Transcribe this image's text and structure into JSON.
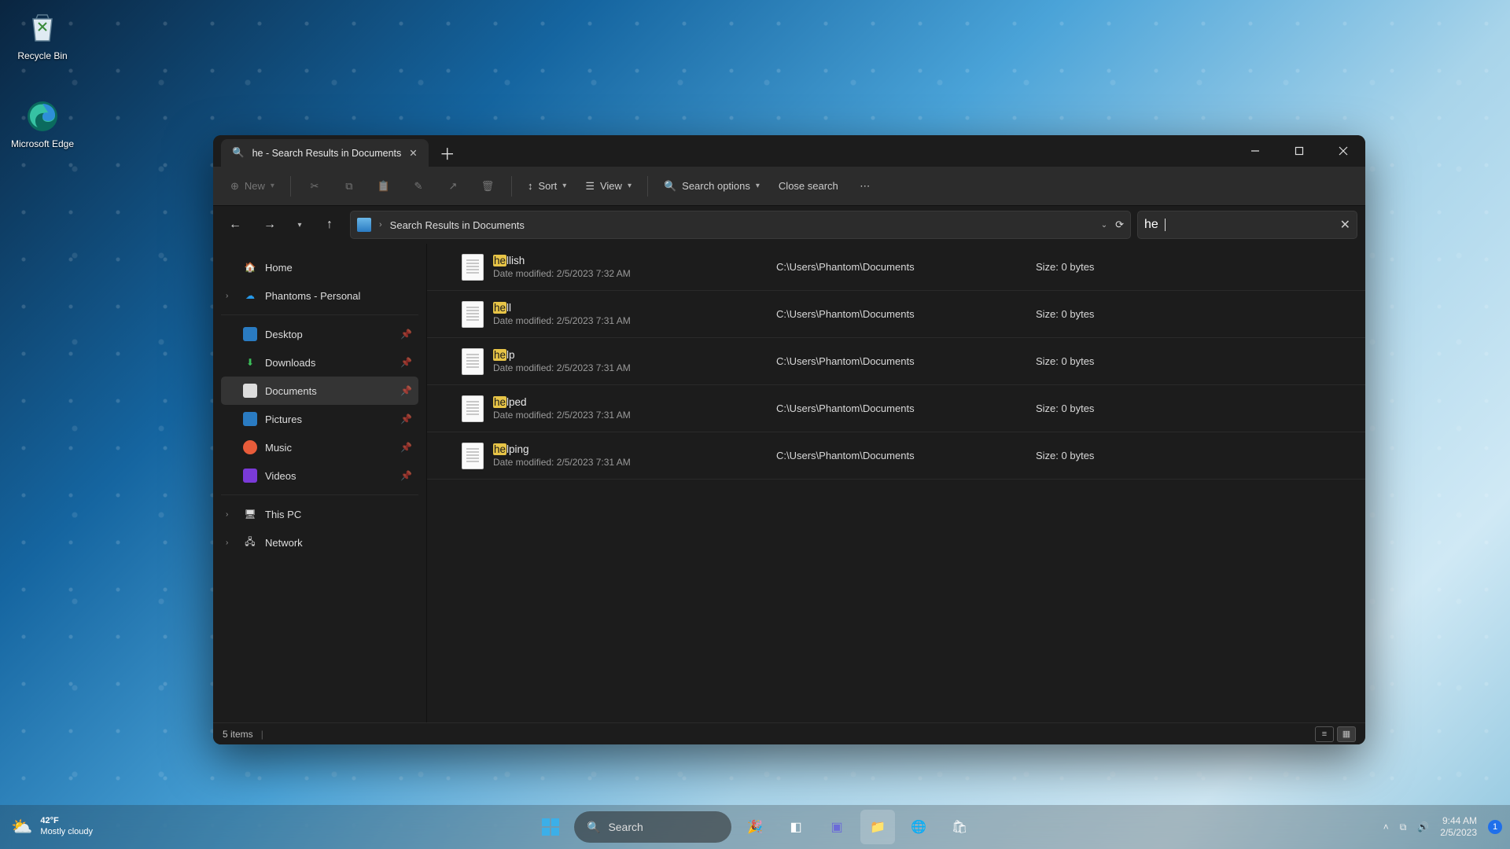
{
  "desktop": {
    "recycle_label": "Recycle Bin",
    "edge_label": "Microsoft Edge"
  },
  "tab": {
    "title": "he - Search Results in Documents"
  },
  "toolbar": {
    "new": "New",
    "sort": "Sort",
    "view": "View",
    "search_options": "Search options",
    "close_search": "Close search"
  },
  "address": {
    "crumb": "Search Results in Documents"
  },
  "search": {
    "query": "he"
  },
  "nav": {
    "home": "Home",
    "onedrive": "Phantoms - Personal",
    "desktop": "Desktop",
    "downloads": "Downloads",
    "documents": "Documents",
    "pictures": "Pictures",
    "music": "Music",
    "videos": "Videos",
    "this_pc": "This PC",
    "network": "Network"
  },
  "modified_prefix": "Date modified: ",
  "size_prefix": "Size: ",
  "results": [
    {
      "name_hl": "he",
      "name_rest": "llish",
      "modified": "2/5/2023 7:32 AM",
      "path": "C:\\Users\\Phantom\\Documents",
      "size": "0 bytes"
    },
    {
      "name_hl": "he",
      "name_rest": "ll",
      "modified": "2/5/2023 7:31 AM",
      "path": "C:\\Users\\Phantom\\Documents",
      "size": "0 bytes"
    },
    {
      "name_hl": "he",
      "name_rest": "lp",
      "modified": "2/5/2023 7:31 AM",
      "path": "C:\\Users\\Phantom\\Documents",
      "size": "0 bytes"
    },
    {
      "name_hl": "he",
      "name_rest": "lped",
      "modified": "2/5/2023 7:31 AM",
      "path": "C:\\Users\\Phantom\\Documents",
      "size": "0 bytes"
    },
    {
      "name_hl": "he",
      "name_rest": "lping",
      "modified": "2/5/2023 7:31 AM",
      "path": "C:\\Users\\Phantom\\Documents",
      "size": "0 bytes"
    }
  ],
  "status": {
    "count": "5 items"
  },
  "taskbar": {
    "search_placeholder": "Search",
    "weather_temp": "42°F",
    "weather_desc": "Mostly cloudy",
    "time": "9:44 AM",
    "date": "2/5/2023",
    "notif_count": "1"
  }
}
